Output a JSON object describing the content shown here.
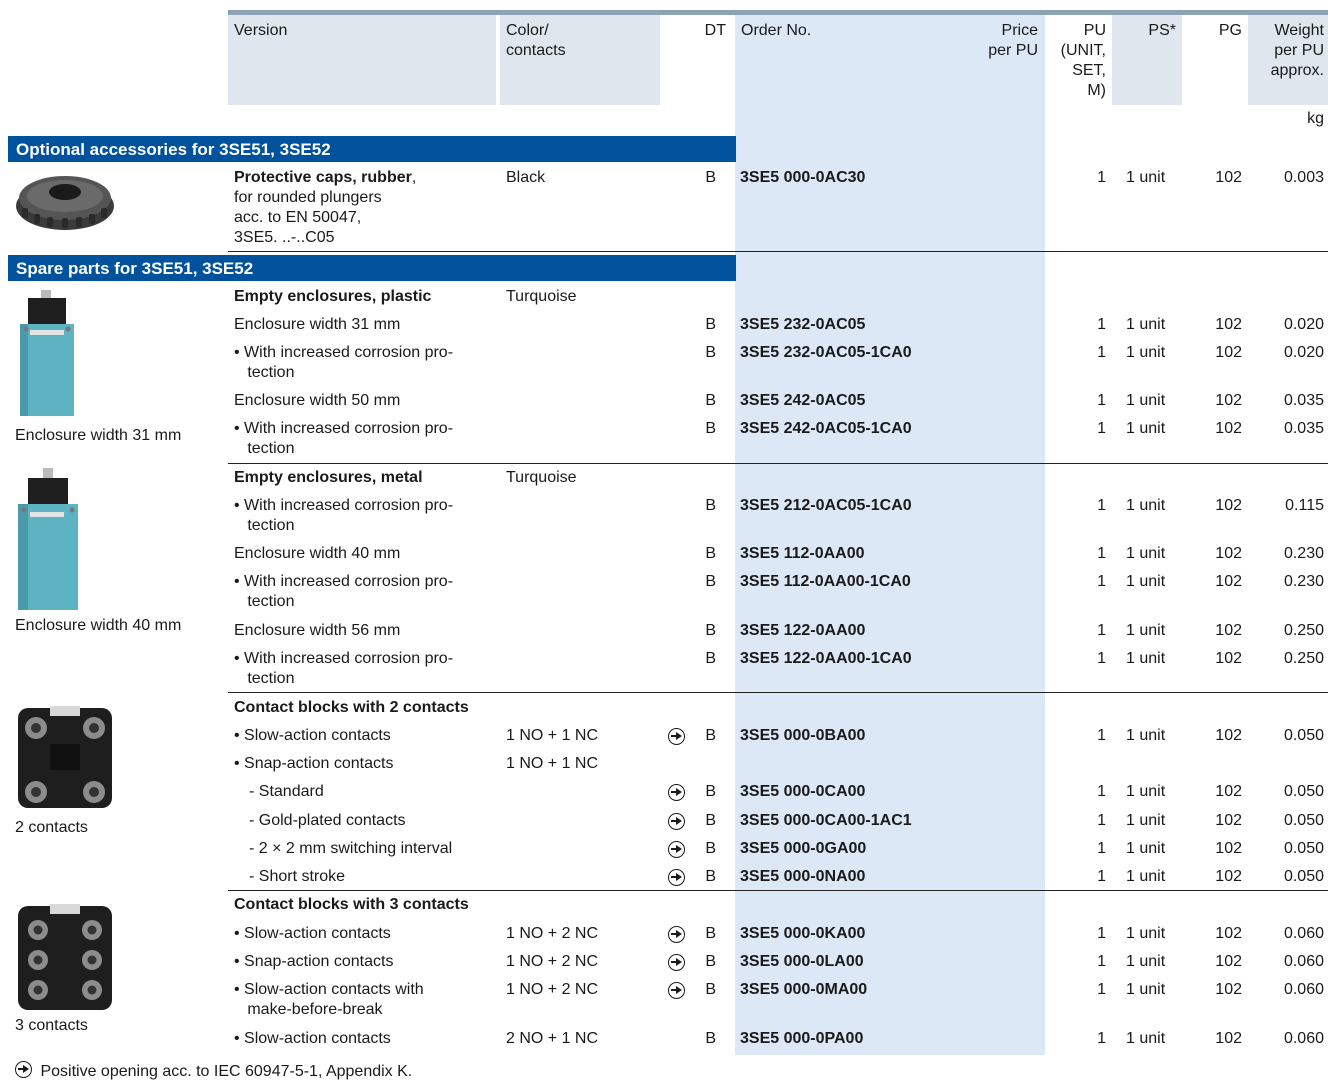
{
  "header": {
    "version": "Version",
    "color_contacts": "Color/\ncontacts",
    "dt": "DT",
    "order_no": "Order No.",
    "price": "Price\nper PU",
    "pu": "PU\n(UNIT,\nSET,\nM)",
    "ps": "PS*",
    "pg": "PG",
    "weight": "Weight\nper PU\napprox.",
    "weight_unit": "kg"
  },
  "sections": [
    {
      "title": "Optional accessories for 3SE51, 3SE52",
      "groups": [
        {
          "image": "rubber-cap-photo",
          "rows": [
            {
              "version_bold": "Protective caps, rubber",
              "version_rest": ",\nfor rounded plungers\nacc. to EN 50047,\n3SE5. ..-..C05",
              "color": "Black",
              "dt": "B",
              "order": "3SE5 000-0AC30",
              "pu": "1",
              "ps": "1 unit",
              "pg": "102",
              "weight": "0.003"
            }
          ]
        }
      ]
    },
    {
      "title": "Spare parts for 3SE51, 3SE52",
      "groups": [
        {
          "caption": "Enclosure width 31 mm",
          "image": "plastic-enclosure-photo",
          "rows": [
            {
              "version": "Empty enclosures, plastic",
              "bold": true,
              "color": "Turquoise"
            },
            {
              "version": "Enclosure width 31 mm",
              "dt": "B",
              "order": "3SE5 232-0AC05",
              "pu": "1",
              "ps": "1 unit",
              "pg": "102",
              "weight": "0.020"
            },
            {
              "version": "• With increased corrosion pro-\n   tection",
              "dt": "B",
              "order": "3SE5 232-0AC05-1CA0",
              "pu": "1",
              "ps": "1 unit",
              "pg": "102",
              "weight": "0.020"
            },
            {
              "version": "Enclosure width 50 mm",
              "dt": "B",
              "order": "3SE5 242-0AC05",
              "pu": "1",
              "ps": "1 unit",
              "pg": "102",
              "weight": "0.035"
            },
            {
              "version": "• With increased corrosion pro-\n   tection",
              "dt": "B",
              "order": "3SE5 242-0AC05-1CA0",
              "pu": "1",
              "ps": "1 unit",
              "pg": "102",
              "weight": "0.035"
            }
          ]
        },
        {
          "caption": "Enclosure width 40 mm",
          "image": "metal-enclosure-photo",
          "rows": [
            {
              "version": "Empty enclosures, metal",
              "bold": true,
              "color": "Turquoise"
            },
            {
              "version": "• With increased corrosion pro-\n   tection",
              "dt": "B",
              "order": "3SE5 212-0AC05-1CA0",
              "pu": "1",
              "ps": "1 unit",
              "pg": "102",
              "weight": "0.115"
            },
            {
              "version": "Enclosure width 40 mm",
              "dt": "B",
              "order": "3SE5 112-0AA00",
              "pu": "1",
              "ps": "1 unit",
              "pg": "102",
              "weight": "0.230"
            },
            {
              "version": "• With increased corrosion pro-\n   tection",
              "dt": "B",
              "order": "3SE5 112-0AA00-1CA0",
              "pu": "1",
              "ps": "1 unit",
              "pg": "102",
              "weight": "0.230"
            },
            {
              "version": "Enclosure width 56 mm",
              "dt": "B",
              "order": "3SE5 122-0AA00",
              "pu": "1",
              "ps": "1 unit",
              "pg": "102",
              "weight": "0.250"
            },
            {
              "version": "• With increased corrosion pro-\n   tection",
              "dt": "B",
              "order": "3SE5 122-0AA00-1CA0",
              "pu": "1",
              "ps": "1 unit",
              "pg": "102",
              "weight": "0.250"
            }
          ]
        },
        {
          "caption": "2 contacts",
          "image": "contact-block-2-photo",
          "rows": [
            {
              "version": "Contact blocks with 2 contacts",
              "bold": true
            },
            {
              "version": "• Slow-action contacts",
              "color": "1 NO + 1 NC",
              "arrow": true,
              "dt": "B",
              "order": "3SE5 000-0BA00",
              "pu": "1",
              "ps": "1 unit",
              "pg": "102",
              "weight": "0.050"
            },
            {
              "version": "• Snap-action contacts",
              "color": "1 NO + 1 NC"
            },
            {
              "version": "- Standard",
              "indent": true,
              "arrow": true,
              "dt": "B",
              "order": "3SE5 000-0CA00",
              "pu": "1",
              "ps": "1 unit",
              "pg": "102",
              "weight": "0.050"
            },
            {
              "version": "- Gold-plated contacts",
              "indent": true,
              "arrow": true,
              "dt": "B",
              "order": "3SE5 000-0CA00-1AC1",
              "pu": "1",
              "ps": "1 unit",
              "pg": "102",
              "weight": "0.050"
            },
            {
              "version": "- 2 × 2 mm switching interval",
              "indent": true,
              "arrow": true,
              "dt": "B",
              "order": "3SE5 000-0GA00",
              "pu": "1",
              "ps": "1 unit",
              "pg": "102",
              "weight": "0.050"
            },
            {
              "version": "- Short stroke",
              "indent": true,
              "arrow": true,
              "dt": "B",
              "order": "3SE5 000-0NA00",
              "pu": "1",
              "ps": "1 unit",
              "pg": "102",
              "weight": "0.050"
            }
          ]
        },
        {
          "caption": "3 contacts",
          "image": "contact-block-3-photo",
          "rows": [
            {
              "version": "Contact blocks with 3 contacts",
              "bold": true
            },
            {
              "version": "• Slow-action contacts",
              "color": "1 NO + 2 NC",
              "arrow": true,
              "dt": "B",
              "order": "3SE5 000-0KA00",
              "pu": "1",
              "ps": "1 unit",
              "pg": "102",
              "weight": "0.060"
            },
            {
              "version": "• Snap-action contacts",
              "color": "1 NO + 2 NC",
              "arrow": true,
              "dt": "B",
              "order": "3SE5 000-0LA00",
              "pu": "1",
              "ps": "1 unit",
              "pg": "102",
              "weight": "0.060"
            },
            {
              "version": "• Slow-action contacts with\n   make-before-break",
              "color": "1 NO + 2 NC",
              "arrow": true,
              "dt": "B",
              "order": "3SE5 000-0MA00",
              "pu": "1",
              "ps": "1 unit",
              "pg": "102",
              "weight": "0.060"
            },
            {
              "version": "• Slow-action contacts",
              "color": "2 NO + 1 NC",
              "dt": "B",
              "order": "3SE5 000-0PA00",
              "pu": "1",
              "ps": "1 unit",
              "pg": "102",
              "weight": "0.060"
            }
          ]
        }
      ]
    }
  ],
  "footnote": "Positive opening acc. to IEC 60947-5-1, Appendix K.",
  "colors": {
    "section_header": "#00529c",
    "order_column": "#dde8f6",
    "header_shade": "#dfe6ed",
    "turquoise_enclosure": "#5eb3c3"
  }
}
